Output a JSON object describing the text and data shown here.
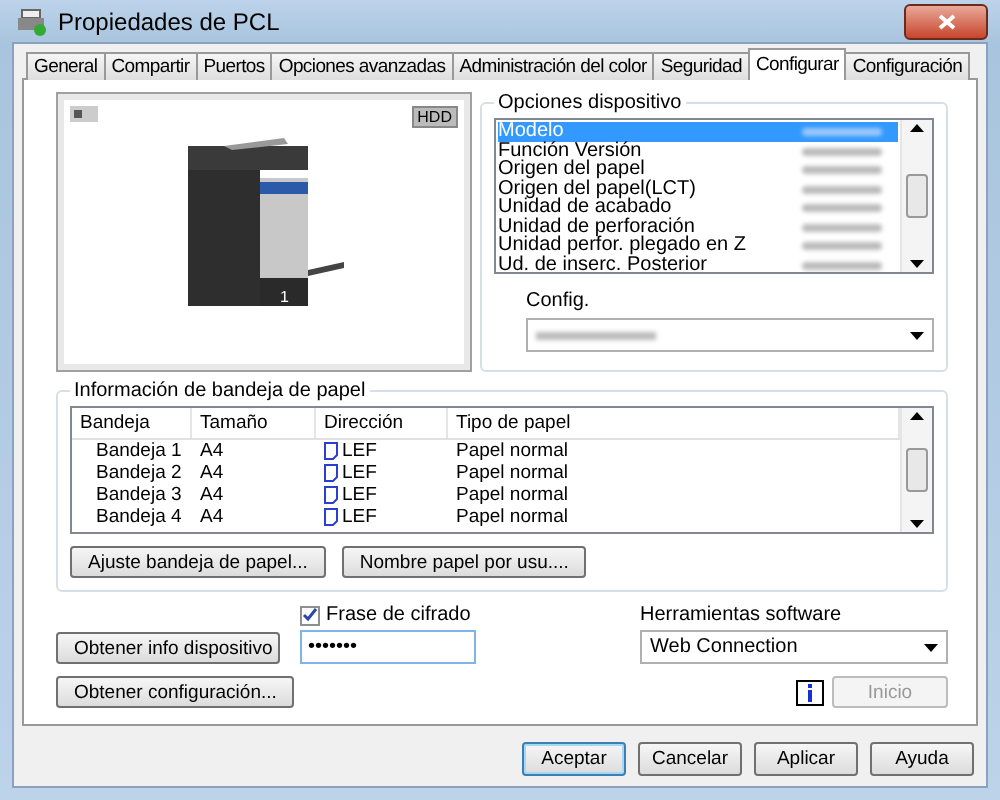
{
  "window": {
    "title": "Propiedades de PCL"
  },
  "tabs": [
    {
      "label": "General",
      "selected": false
    },
    {
      "label": "Compartir",
      "selected": false
    },
    {
      "label": "Puertos",
      "selected": false
    },
    {
      "label": "Opciones avanzadas",
      "selected": false
    },
    {
      "label": "Administración del color",
      "selected": false
    },
    {
      "label": "Seguridad",
      "selected": false
    },
    {
      "label": "Configurar",
      "selected": true
    },
    {
      "label": "Configuración",
      "selected": false
    }
  ],
  "preview": {
    "badge": "HDD",
    "tray_number": "1"
  },
  "device_options": {
    "title": "Opciones dispositivo",
    "items": [
      {
        "label": "Modelo",
        "selected": true
      },
      {
        "label": "Función Versión",
        "selected": false
      },
      {
        "label": "Origen del papel",
        "selected": false
      },
      {
        "label": "Origen del papel(LCT)",
        "selected": false
      },
      {
        "label": "Unidad de acabado",
        "selected": false
      },
      {
        "label": "Unidad de perforación",
        "selected": false
      },
      {
        "label": "Unidad perfor. plegado en Z",
        "selected": false
      },
      {
        "label": "Ud. de inserc. Posterior",
        "selected": false
      }
    ],
    "config_label": "Config."
  },
  "tray_info": {
    "title": "Información de bandeja de papel",
    "columns": [
      "Bandeja",
      "Tamaño",
      "Dirección",
      "Tipo de papel"
    ],
    "rows": [
      [
        "Bandeja 1",
        "A4",
        "LEF",
        "Papel normal"
      ],
      [
        "Bandeja 2",
        "A4",
        "LEF",
        "Papel normal"
      ],
      [
        "Bandeja 3",
        "A4",
        "LEF",
        "Papel normal"
      ],
      [
        "Bandeja 4",
        "A4",
        "LEF",
        "Papel normal"
      ]
    ],
    "buttons": [
      "Ajuste bandeja de papel...",
      "Nombre papel por usu...."
    ]
  },
  "device_info_button": "Obtener info dispositivo",
  "get_config_button": "Obtener configuración...",
  "passphrase": {
    "label": "Frase de cifrado",
    "checked": true,
    "value": "•••••••"
  },
  "software_tools": {
    "label": "Herramientas software",
    "value": "Web Connection",
    "start_button": "Inicio",
    "start_disabled": true
  },
  "dialog_buttons": [
    "Aceptar",
    "Cancelar",
    "Aplicar",
    "Ayuda"
  ]
}
